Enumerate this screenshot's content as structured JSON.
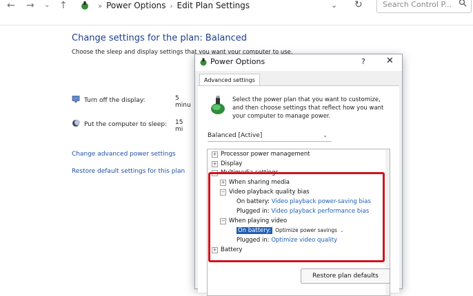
{
  "addressbar": {
    "path": [
      "Power Options",
      "Edit Plan Settings"
    ],
    "search_placeholder": "Search Control P..."
  },
  "page": {
    "title": "Change settings for the plan: Balanced",
    "subtitle": "Choose the sleep and display settings that you want your computer to use.",
    "options": [
      {
        "label": "Turn off the display:",
        "value": "5 minu"
      },
      {
        "label": "Put the computer to sleep:",
        "value": "15 mi"
      }
    ],
    "links": [
      "Change advanced power settings",
      "Restore default settings for this plan"
    ]
  },
  "dialog": {
    "title": "Power Options",
    "help": "?",
    "close": "✕",
    "tab": "Advanced settings",
    "intro": "Select the power plan that you want to customize, and then choose settings that reflect how you want your computer to manage power.",
    "plan_selected": "Balanced [Active]",
    "tree": {
      "processor": "Processor power management",
      "display": "Display",
      "multimedia": "Multimedia settings",
      "sharing": "When sharing media",
      "video_bias": "Video playback quality bias",
      "bias_battery_label": "On battery:",
      "bias_battery_value": "Video playback power-saving bias",
      "bias_plugged_label": "Plugged in:",
      "bias_plugged_value": "Video playback performance bias",
      "playing": "When playing video",
      "play_battery_label": "On battery:",
      "play_battery_value": "Optimize power savings",
      "play_plugged_label": "Plugged in:",
      "play_plugged_value": "Optimize video quality",
      "battery": "Battery"
    },
    "restore_button": "Restore plan defaults"
  },
  "colors": {
    "accent": "#1f5fb5",
    "title_blue": "#1e3d8f",
    "highlight": "#d0111b"
  }
}
